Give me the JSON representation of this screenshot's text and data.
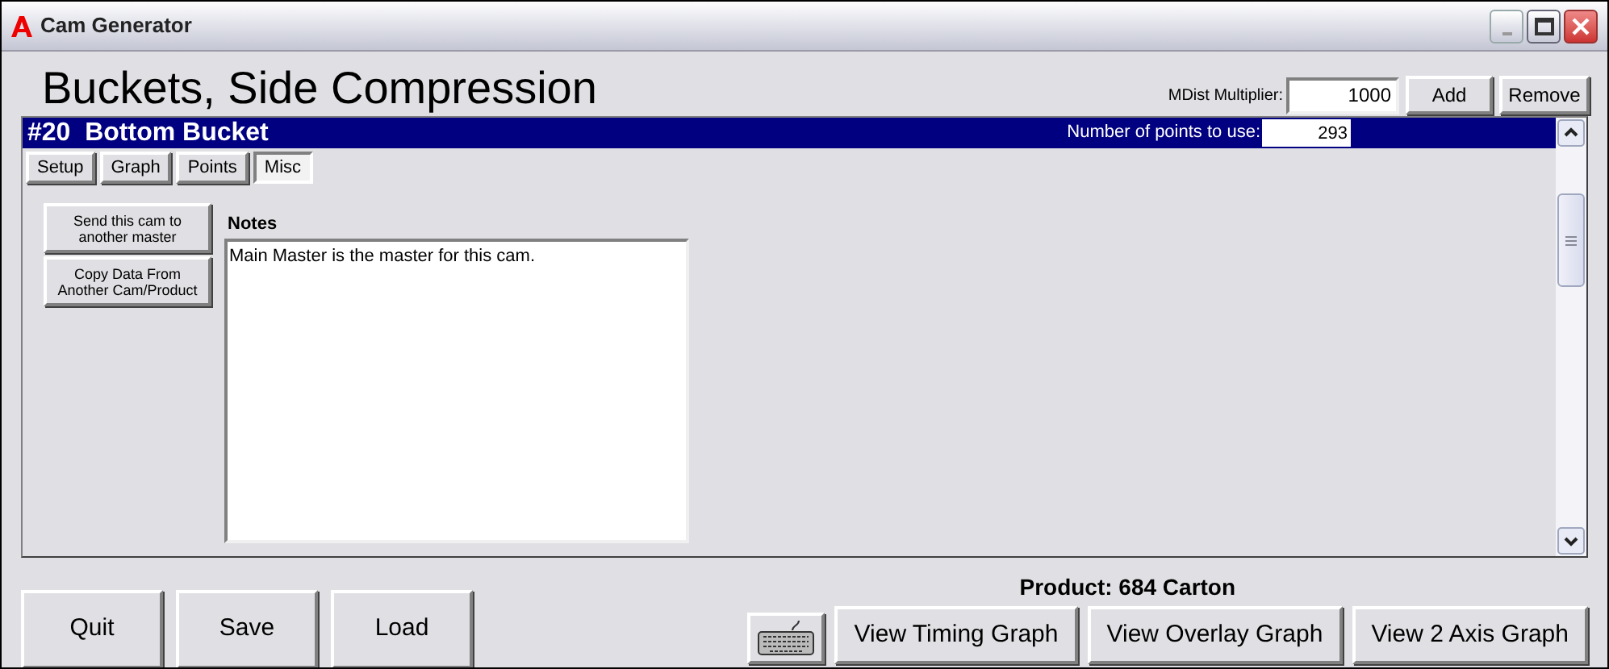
{
  "window": {
    "title": "Cam Generator"
  },
  "heading": "Buckets, Side Compression",
  "mdist": {
    "label": "MDist Multiplier:",
    "value": "1000"
  },
  "header_buttons": [
    "Add",
    "Remove"
  ],
  "cam": {
    "title": "#20  Bottom Bucket",
    "points_label": "Number of points to use:",
    "points_value": "293"
  },
  "tabs": [
    {
      "label": "Setup",
      "selected": false
    },
    {
      "label": "Graph",
      "selected": false
    },
    {
      "label": "Points",
      "selected": false
    },
    {
      "label": "Misc",
      "selected": true
    }
  ],
  "side_buttons": [
    "Send this cam to another master",
    "Copy Data From Another Cam/Product"
  ],
  "notes": {
    "label": "Notes",
    "value": "Main Master is the master for this cam."
  },
  "product": "Product: 684 Carton",
  "bottom_buttons": [
    "Quit",
    "Save",
    "Load"
  ],
  "view_buttons": [
    "View Timing Graph",
    "View Overlay Graph",
    "View 2 Axis Graph"
  ]
}
